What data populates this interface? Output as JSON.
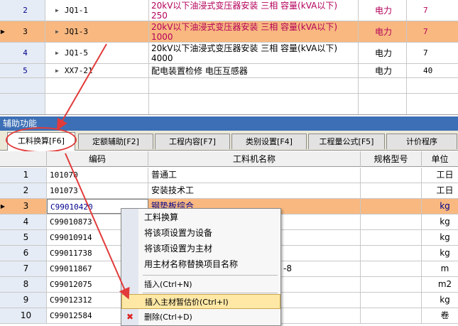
{
  "top_grid": {
    "rows": [
      {
        "num": "2",
        "code": "JQ1-1",
        "name": "20kV以下油浸式变压器安装 三相 容量(kVA以下)\n250",
        "unit": "电力",
        "qty": "7",
        "style": "red"
      },
      {
        "num": "3",
        "code": "JQ1-3",
        "name": "20kV以下油浸式变压器安装 三相 容量(kVA以下)\n1000",
        "unit": "电力",
        "qty": "7",
        "style": "red"
      },
      {
        "num": "4",
        "code": "JQ1-5",
        "name": "20kV以下油浸式变压器安装 三相 容量(kVA以下)\n4000",
        "unit": "电力",
        "qty": "7",
        "style": "normal"
      },
      {
        "num": "5",
        "code": "XX7-21",
        "name": "配电装置检修 电压互感器",
        "unit": "电力",
        "qty": "40",
        "style": "normal"
      }
    ]
  },
  "aux_panel": {
    "title": "辅助功能",
    "tabs": [
      {
        "label": "工料换算[F6]"
      },
      {
        "label": "定额辅助[F2]"
      },
      {
        "label": "工程内容[F7]"
      },
      {
        "label": "类别设置[F4]"
      },
      {
        "label": "工程量公式[F5]"
      },
      {
        "label": "计价程序"
      }
    ]
  },
  "bottom_grid": {
    "headers": {
      "code": "编码",
      "name": "工料机名称",
      "spec": "规格型号",
      "unit": "单位"
    },
    "rows": [
      {
        "num": "1",
        "code": "101070",
        "name": "普通工",
        "spec": "",
        "unit": "工日"
      },
      {
        "num": "2",
        "code": "101073",
        "name": "安装技术工",
        "spec": "",
        "unit": "工日"
      },
      {
        "num": "3",
        "code": "C99010420",
        "name": "钢垫板综合",
        "spec": "",
        "unit": "kg"
      },
      {
        "num": "4",
        "code": "C99010873",
        "name": "",
        "spec": "",
        "unit": "kg"
      },
      {
        "num": "5",
        "code": "C99010914",
        "name": "",
        "spec": "",
        "unit": "kg"
      },
      {
        "num": "6",
        "code": "C99011738",
        "name": "",
        "spec": "",
        "unit": "kg"
      },
      {
        "num": "7",
        "code": "C99011867",
        "name": "-8",
        "spec": "",
        "unit": "m"
      },
      {
        "num": "8",
        "code": "C99012075",
        "name": "",
        "spec": "",
        "unit": "m2"
      },
      {
        "num": "9",
        "code": "C99012312",
        "name": "",
        "spec": "",
        "unit": "kg"
      },
      {
        "num": "10",
        "code": "C99012584",
        "name": "",
        "spec": "",
        "unit": "卷"
      }
    ]
  },
  "context_menu": {
    "items": [
      {
        "label": "工料换算"
      },
      {
        "label": "将该项设置为设备"
      },
      {
        "label": "将该项设置为主材"
      },
      {
        "label": "用主材名称替换项目名称"
      },
      {
        "label": "插入(Ctrl+N)"
      },
      {
        "label": "插入主材暂估价(Ctrl+I)"
      },
      {
        "label": "删除(Ctrl+D)"
      }
    ]
  },
  "colors": {
    "selection": "#f8b880",
    "annotation_red": "#e23b3b",
    "panel_title": "#3c6fb5",
    "menu_highlight": "#ffe8a6"
  }
}
